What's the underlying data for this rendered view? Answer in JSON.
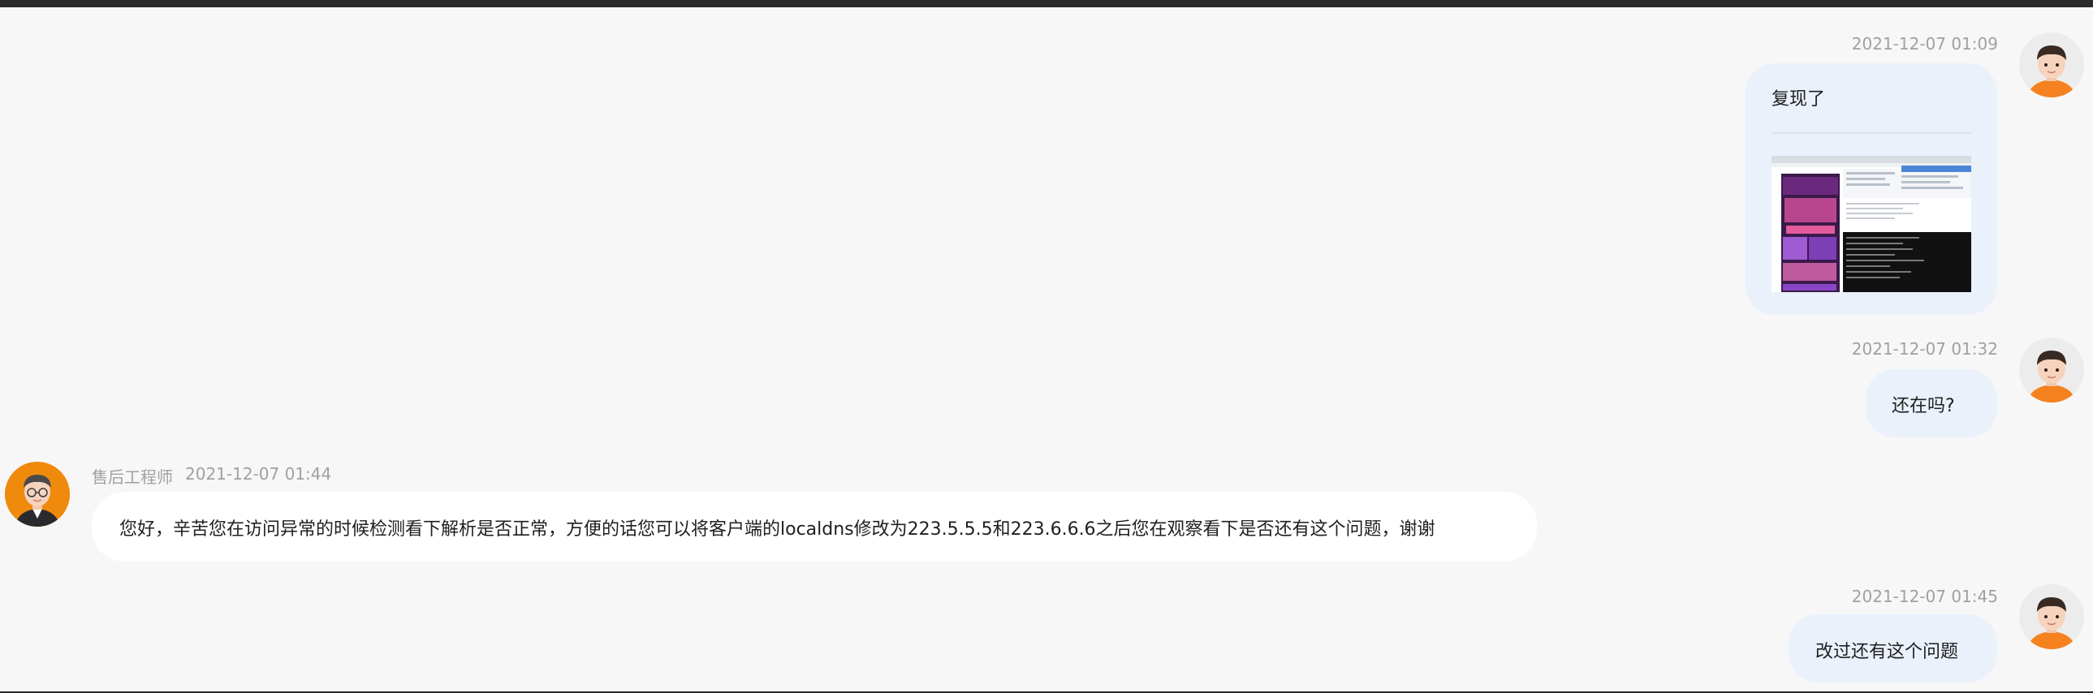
{
  "messages": [
    {
      "timestamp": "2021-12-07 01:09",
      "text": "复现了",
      "has_image": true
    },
    {
      "timestamp": "2021-12-07 01:32",
      "text": "还在吗?"
    },
    {
      "sender": "售后工程师",
      "timestamp": "2021-12-07 01:44",
      "text": "您好，辛苦您在访问异常的时候检测看下解析是否正常，方便的话您可以将客户端的localdns修改为223.5.5.5和223.6.6.6之后您在观察看下是否还有这个问题，谢谢"
    },
    {
      "timestamp": "2021-12-07 01:45",
      "text": "改过还有这个问题"
    }
  ],
  "colors": {
    "background": "#f7f7f7",
    "user_bubble": "#eaf1fb",
    "agent_bubble": "#ffffff",
    "meta_text": "#a0a0a0",
    "avatar_shirt_user": "#f5821f",
    "avatar_agent_ring": "#f08a0c"
  },
  "icons": {
    "user_avatar": "user-avatar",
    "agent_avatar": "agent-avatar"
  }
}
